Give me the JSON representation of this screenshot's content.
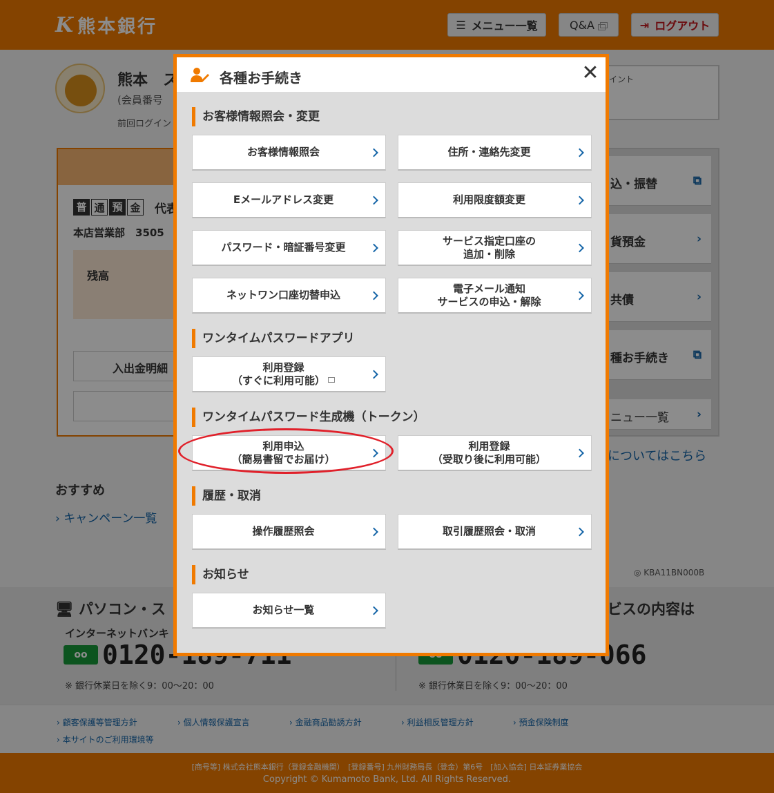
{
  "header": {
    "logo_text": "熊本銀行",
    "menu_label": "メニュー一覧",
    "qa_label": "Q&A",
    "logout_label": "ログアウト"
  },
  "profile": {
    "name": "熊本　ス",
    "member_no": "(会員番号",
    "last_login": "前回ログイン",
    "point_label": "イント"
  },
  "account": {
    "type_chars": [
      "普",
      "通",
      "預",
      "金"
    ],
    "rep": "代表",
    "branch": "本店営業部　3505",
    "balance_label": "残高",
    "detail_button": "入出金明細"
  },
  "sidemenu": {
    "items": [
      "込・振替",
      "貨預金",
      "共債",
      "種お手続き",
      "ニュー一覧"
    ]
  },
  "about_link": "についてはこちら",
  "recommend": {
    "title": "おすすめ",
    "campaign": "キャンペーン一覧"
  },
  "screen_id": "KBA11BN000B",
  "contact": {
    "left_title": "パソコン・ス",
    "right_title": "ビスの内容は",
    "left_sub": "インターネットバンキ",
    "left_tel": "0120-189-711",
    "right_tel": "0120-189-066",
    "hours": "※ 銀行休業日を除く9：00〜20：00"
  },
  "links": [
    "顧客保護等管理方針",
    "個人情報保護宣言",
    "金融商品勧誘方針",
    "利益相反管理方針",
    "預金保険制度",
    "本サイトのご利用環境等"
  ],
  "footer": {
    "line1": "[商号等] 株式会社熊本銀行（登録金融機関）　[登録番号] 九州財務局長（登金）第6号　[加入協会] 日本証券業協会",
    "line2": "Copyright © Kumamoto Bank, Ltd. All Rights Reserved."
  },
  "modal": {
    "title": "各種お手続き",
    "sections": {
      "customer": "お客様情報照会・変更",
      "app": "ワンタイムパスワードアプリ",
      "token": "ワンタイムパスワード生成機（トークン）",
      "history": "履歴・取消",
      "notice": "お知らせ"
    },
    "buttons": {
      "customer_info": "お客様情報照会",
      "address_change": "住所・連絡先変更",
      "email_change": "Eメールアドレス変更",
      "limit_change": "利用限度額変更",
      "password_change": "パスワード・暗証番号変更",
      "service_account_l1": "サービス指定口座の",
      "service_account_l2": "追加・削除",
      "netone_switch": "ネットワン口座切替申込",
      "email_notice_l1": "電子メール通知",
      "email_notice_l2": "サービスの申込・解除",
      "app_register_l1": "利用登録",
      "app_register_l2": "（すぐに利用可能）",
      "token_apply_l1": "利用申込",
      "token_apply_l2": "（簡易書留でお届け）",
      "token_register_l1": "利用登録",
      "token_register_l2": "（受取り後に利用可能）",
      "operation_history": "操作履歴照会",
      "transaction_history": "取引履歴照会・取消",
      "notice_list": "お知らせ一覧"
    }
  }
}
